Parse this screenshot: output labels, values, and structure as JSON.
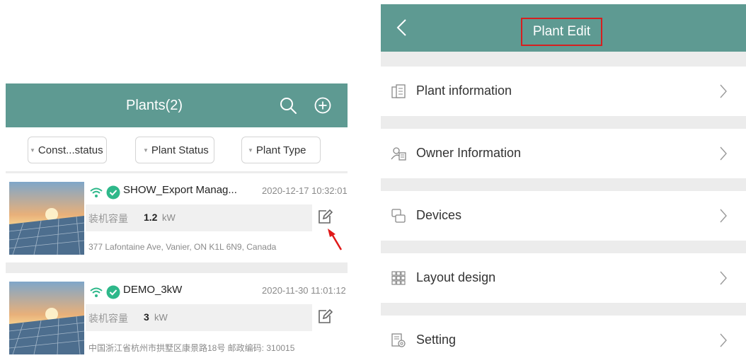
{
  "left_screen": {
    "header": {
      "title": "Plants(2)",
      "search_icon": "search-icon",
      "add_icon": "plus-circle-icon"
    },
    "filters": [
      {
        "label": "Const...status"
      },
      {
        "label": "Plant Status"
      },
      {
        "label": "Plant Type"
      }
    ],
    "plants": [
      {
        "name": "SHOW_Export Manag...",
        "timestamp": "2020-12-17 10:32:01",
        "capacity_label": "装机容量",
        "capacity_value": "1.2",
        "capacity_unit": "kW",
        "address": "377 Lafontaine Ave, Vanier, ON K1L 6N9, Canada"
      },
      {
        "name": "DEMO_3kW",
        "timestamp": "2020-11-30 11:01:12",
        "capacity_label": "装机容量",
        "capacity_value": "3",
        "capacity_unit": "kW",
        "address": "中国浙江省杭州市拱墅区康景路18号 邮政编码: 310015"
      }
    ]
  },
  "right_screen": {
    "header": {
      "title": "Plant Edit",
      "back_icon": "chevron-left-icon"
    },
    "menu": [
      {
        "label": "Plant information",
        "icon": "building-icon"
      },
      {
        "label": "Owner Information",
        "icon": "person-card-icon"
      },
      {
        "label": "Devices",
        "icon": "devices-icon"
      },
      {
        "label": "Layout design",
        "icon": "grid-icon"
      },
      {
        "label": "Setting",
        "icon": "settings-doc-icon"
      }
    ]
  },
  "colors": {
    "header_green": "#5e9a92",
    "status_green": "#2eb88a",
    "highlight_red": "#d61f1f"
  }
}
